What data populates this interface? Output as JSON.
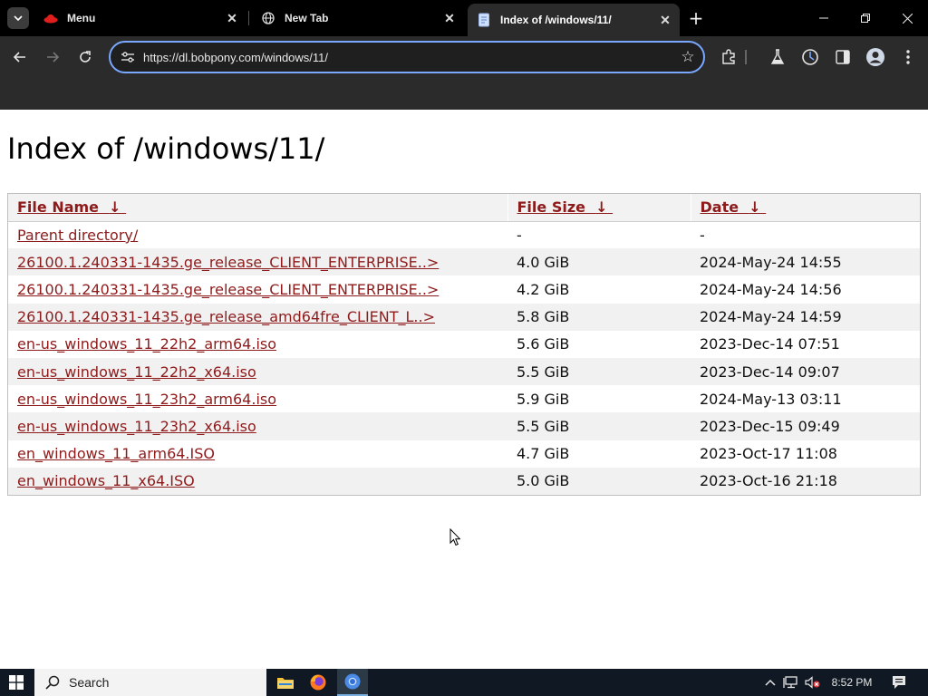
{
  "browser": {
    "tabs": [
      {
        "title": "Menu",
        "icon": "red-hat-icon"
      },
      {
        "title": "New Tab",
        "icon": "globe-icon"
      },
      {
        "title": "Index of /windows/11/",
        "icon": "document-icon",
        "active": true
      }
    ],
    "url": "https://dl.bobpony.com/windows/11/",
    "colors": {
      "accent": "#7aa7ff",
      "chrome_bg": "#2b2b2b",
      "tabstrip_bg": "#000000"
    }
  },
  "page": {
    "heading": "Index of /windows/11/",
    "columns": [
      {
        "label": "File Name",
        "sort_arrow": "↓"
      },
      {
        "label": "File Size",
        "sort_arrow": "↓"
      },
      {
        "label": "Date",
        "sort_arrow": "↓"
      }
    ],
    "rows": [
      {
        "name": "Parent directory/",
        "size": "-",
        "date": "-"
      },
      {
        "name": "26100.1.240331-1435.ge_release_CLIENT_ENTERPRISE..>",
        "size": "4.0 GiB",
        "date": "2024-May-24 14:55"
      },
      {
        "name": "26100.1.240331-1435.ge_release_CLIENT_ENTERPRISE..>",
        "size": "4.2 GiB",
        "date": "2024-May-24 14:56"
      },
      {
        "name": "26100.1.240331-1435.ge_release_amd64fre_CLIENT_L..>",
        "size": "5.8 GiB",
        "date": "2024-May-24 14:59"
      },
      {
        "name": "en-us_windows_11_22h2_arm64.iso",
        "size": "5.6 GiB",
        "date": "2023-Dec-14 07:51"
      },
      {
        "name": "en-us_windows_11_22h2_x64.iso",
        "size": "5.5 GiB",
        "date": "2023-Dec-14 09:07"
      },
      {
        "name": "en-us_windows_11_23h2_arm64.iso",
        "size": "5.9 GiB",
        "date": "2024-May-13 03:11"
      },
      {
        "name": "en-us_windows_11_23h2_x64.iso",
        "size": "5.5 GiB",
        "date": "2023-Dec-15 09:49"
      },
      {
        "name": "en_windows_11_arm64.ISO",
        "size": "4.7 GiB",
        "date": "2023-Oct-17 11:08"
      },
      {
        "name": "en_windows_11_x64.ISO",
        "size": "5.0 GiB",
        "date": "2023-Oct-16 21:18"
      }
    ],
    "colors": {
      "link": "#8e1b1b",
      "header_bg": "#f2f2f2",
      "stripe_bg": "#f1f1f1"
    }
  },
  "taskbar": {
    "search_label": "Search",
    "time": "8:52 PM",
    "apps": [
      "file-explorer-icon",
      "firefox-icon",
      "chrome-icon"
    ]
  }
}
